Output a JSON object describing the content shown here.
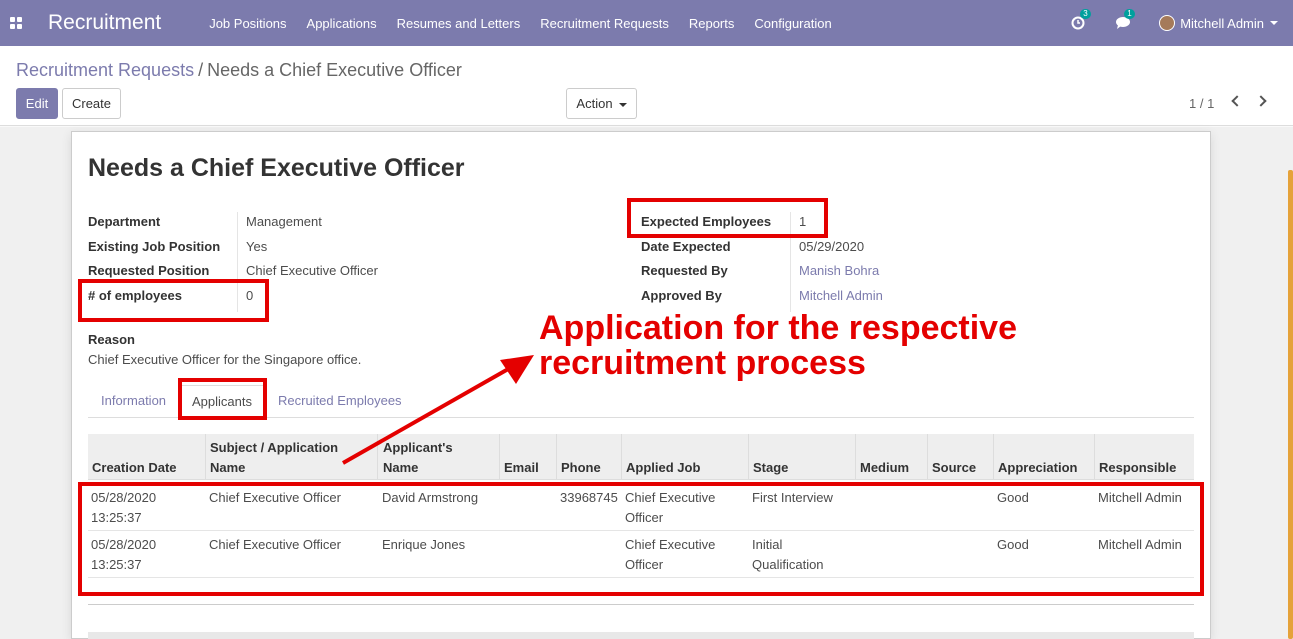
{
  "app": {
    "name": "Recruitment",
    "menu": [
      "Job Positions",
      "Applications",
      "Resumes and Letters",
      "Recruitment Requests",
      "Reports",
      "Configuration"
    ],
    "activity_count": "3",
    "message_count": "1",
    "user": "Mitchell Admin"
  },
  "breadcrumb": {
    "parent": "Recruitment Requests",
    "separator": "/",
    "current": "Needs a Chief Executive Officer"
  },
  "buttons": {
    "edit": "Edit",
    "create": "Create",
    "action": "Action"
  },
  "pager": "1 / 1",
  "form": {
    "title": "Needs a Chief Executive Officer",
    "left_fields": [
      {
        "label": "Department",
        "value": "Management"
      },
      {
        "label": "Existing Job Position",
        "value": "Yes"
      },
      {
        "label": "Requested Position",
        "value": "Chief Executive Officer"
      },
      {
        "label": "# of employees",
        "value": "0"
      }
    ],
    "right_fields": [
      {
        "label": "Expected Employees",
        "value": "1"
      },
      {
        "label": "Date Expected",
        "value": "05/29/2020"
      },
      {
        "label": "Requested By",
        "value": "Manish Bohra"
      },
      {
        "label": "Approved By",
        "value": "Mitchell Admin"
      }
    ],
    "reason_label": "Reason",
    "reason_text": "Chief Executive Officer for the Singapore office."
  },
  "tabs": [
    "Information",
    "Applicants",
    "Recruited Employees"
  ],
  "table": {
    "headers": [
      "Creation Date",
      "Subject / Application Name",
      "Applicant's Name",
      "Email",
      "Phone",
      "Applied Job",
      "Stage",
      "Medium",
      "Source",
      "Appreciation",
      "Responsible"
    ],
    "rows": [
      {
        "date1": "05/28/2020",
        "date2": "13:25:37",
        "subject": "Chief Executive Officer",
        "applicant": "David Armstrong",
        "email": "",
        "phone": "33968745",
        "job1": "Chief Executive",
        "job2": "Officer",
        "stage1": "First Interview",
        "stage2": "",
        "medium": "",
        "source": "",
        "appreciation": "Good",
        "responsible": "Mitchell Admin"
      },
      {
        "date1": "05/28/2020",
        "date2": "13:25:37",
        "subject": "Chief Executive Officer",
        "applicant": "Enrique Jones",
        "email": "",
        "phone": "",
        "job1": "Chief Executive",
        "job2": "Officer",
        "stage1": "Initial",
        "stage2": "Qualification",
        "medium": "",
        "source": "",
        "appreciation": "Good",
        "responsible": "Mitchell Admin"
      }
    ]
  },
  "annotation": {
    "line1": "Application for the respective",
    "line2": "recruitment process",
    "color": "#e40000"
  }
}
